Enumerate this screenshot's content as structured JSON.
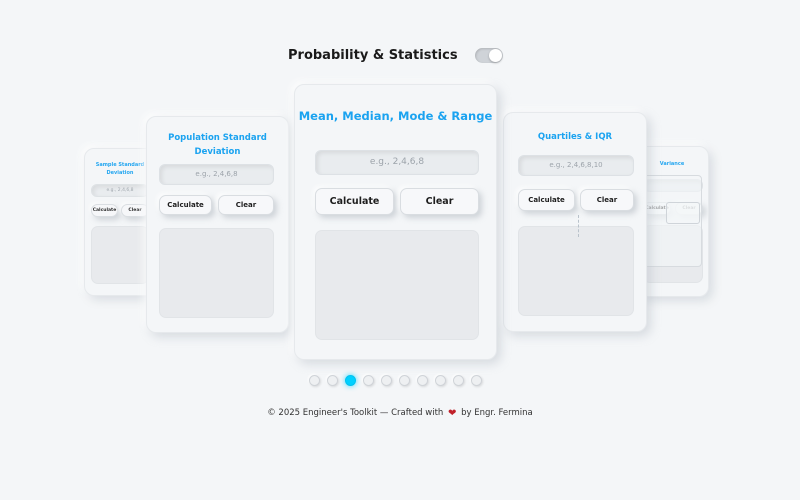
{
  "header": {
    "title": "Probability & Statistics",
    "theme_toggle_state": "off"
  },
  "cards": {
    "far_left": {
      "title": "Sample Standard Deviation",
      "input_placeholder": "e.g., 2,4,6,8",
      "calculate_label": "Calculate",
      "clear_label": "Clear"
    },
    "left": {
      "title": "Population Standard Deviation",
      "input_placeholder": "e.g., 2,4,6,8",
      "calculate_label": "Calculate",
      "clear_label": "Clear"
    },
    "center": {
      "title": "Mean, Median, Mode & Range",
      "input_placeholder": "e.g., 2,4,6,8",
      "calculate_label": "Calculate",
      "clear_label": "Clear"
    },
    "right": {
      "title": "Quartiles & IQR",
      "input_placeholder": "e.g., 2,4,6,8,10",
      "calculate_label": "Calculate",
      "clear_label": "Clear"
    },
    "far_right": {
      "title": "Variance",
      "input_placeholder": "",
      "calculate_label": "Calculate",
      "clear_label": "Clear"
    }
  },
  "pagination": {
    "total": 10,
    "active_index": 2
  },
  "footer": {
    "prefix": "© 2025 Engineer's Toolkit — Crafted with",
    "suffix": "by Engr. Fermina",
    "heart_icon": "heart-icon"
  },
  "colors": {
    "accent": "#1ba3f0",
    "active_dot": "#00d0ff",
    "background": "#f4f6f8",
    "heart": "#c0202a"
  }
}
